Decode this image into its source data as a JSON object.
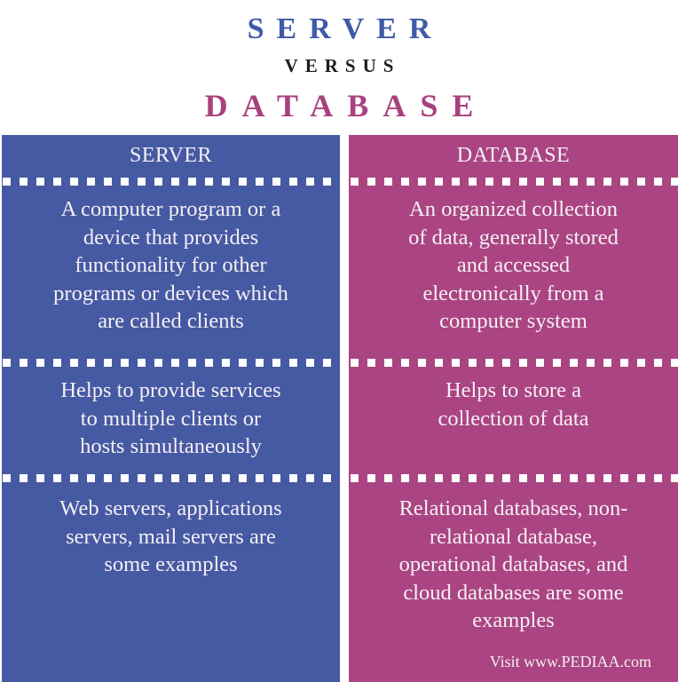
{
  "title": {
    "left_term": "SERVER",
    "connector": "VERSUS",
    "right_term": "DATABASE"
  },
  "colors": {
    "server_blue": "#4659a3",
    "database_magenta": "#ab4482",
    "title_blue": "#3f5aa6",
    "title_magenta": "#a8427e",
    "versus_dark": "#1e1e1e",
    "text_light": "#f4f0f4"
  },
  "columns": [
    {
      "header": "SERVER",
      "rows": [
        {
          "aspect": "definition",
          "lines": [
            "A computer program or a",
            "device that provides",
            "functionality for other",
            "programs or devices which",
            "are called clients"
          ]
        },
        {
          "aspect": "function",
          "lines": [
            "Helps to provide services",
            "to multiple clients or",
            "hosts simultaneously"
          ]
        },
        {
          "aspect": "examples",
          "lines": [
            "Web servers, applications",
            "servers, mail servers are",
            "some examples"
          ]
        }
      ]
    },
    {
      "header": "DATABASE",
      "rows": [
        {
          "aspect": "definition",
          "lines": [
            "An organized collection",
            "of data, generally stored",
            "and accessed",
            "electronically from a",
            "computer system"
          ]
        },
        {
          "aspect": "function",
          "lines": [
            "Helps to store a",
            "collection of data"
          ]
        },
        {
          "aspect": "examples",
          "lines": [
            "Relational databases, non-",
            "relational database,",
            "operational databases, and",
            "cloud databases are some",
            "examples"
          ]
        }
      ]
    }
  ],
  "footer": "Visit www.PEDIAA.com"
}
